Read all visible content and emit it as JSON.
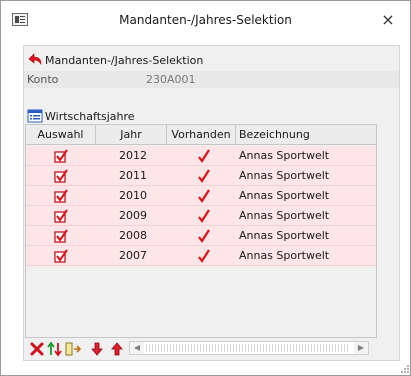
{
  "window": {
    "title": "Mandanten-/Jahres-Selektion",
    "close_glyph": "×"
  },
  "section1": {
    "title": "Mandanten-/Jahres-Selektion",
    "icon": "undo-arrow-icon"
  },
  "konto": {
    "label": "Konto",
    "value": "230A001"
  },
  "section2": {
    "title": "Wirtschaftsjahre",
    "icon": "list-icon"
  },
  "grid": {
    "columns": [
      "Auswahl",
      "Jahr",
      "Vorhanden",
      "Bezeichnung"
    ],
    "rows": [
      {
        "selected": true,
        "jahr": "2012",
        "vorhanden": true,
        "bezeichnung": "Annas Sportwelt"
      },
      {
        "selected": true,
        "jahr": "2011",
        "vorhanden": true,
        "bezeichnung": "Annas Sportwelt"
      },
      {
        "selected": true,
        "jahr": "2010",
        "vorhanden": true,
        "bezeichnung": "Annas Sportwelt"
      },
      {
        "selected": true,
        "jahr": "2009",
        "vorhanden": true,
        "bezeichnung": "Annas Sportwelt"
      },
      {
        "selected": true,
        "jahr": "2008",
        "vorhanden": true,
        "bezeichnung": "Annas Sportwelt"
      },
      {
        "selected": true,
        "jahr": "2007",
        "vorhanden": true,
        "bezeichnung": "Annas Sportwelt"
      }
    ]
  },
  "footer": {
    "buttons": [
      "delete-icon",
      "sort-icon",
      "move-column-icon",
      "move-down-icon",
      "move-up-icon"
    ]
  },
  "colors": {
    "accent_red": "#e0101a",
    "row_bg": "#fde5e8",
    "panel_bg": "#f0f0f0"
  }
}
